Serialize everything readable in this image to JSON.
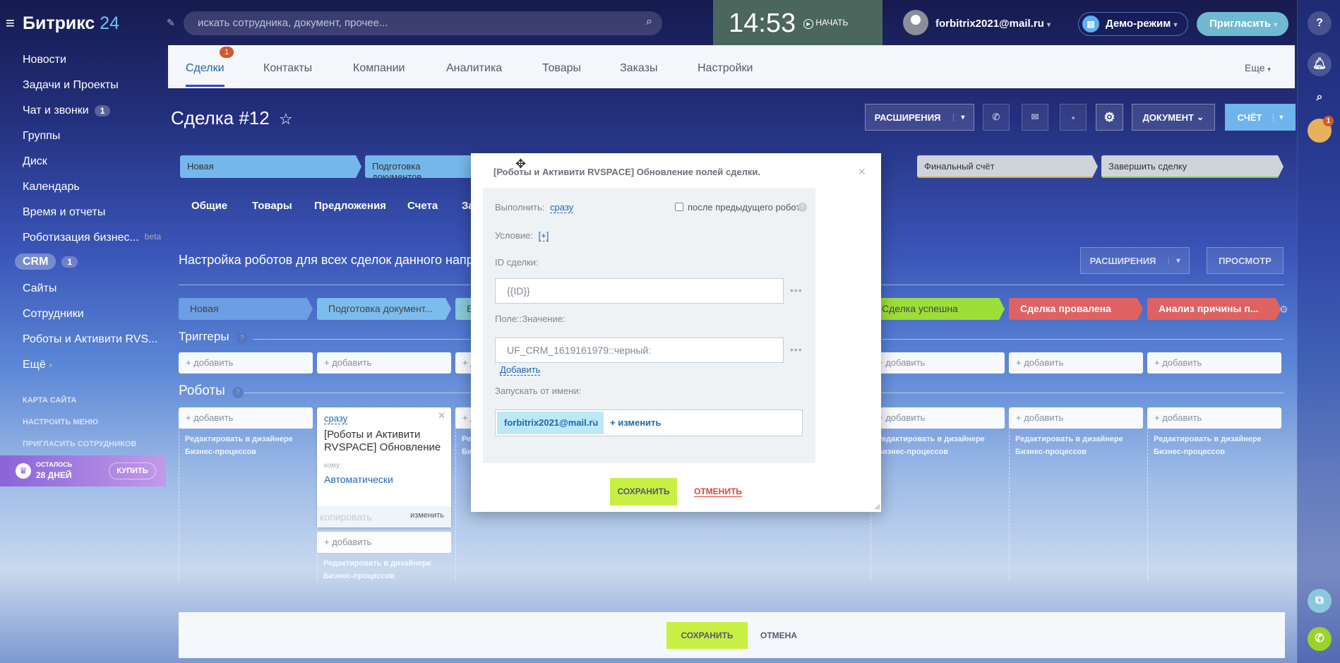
{
  "header": {
    "logo": "Битрикс",
    "logo_num": "24",
    "search_placeholder": "искать сотрудника, документ, прочее...",
    "time": "14:53",
    "start_label": "НАЧАТЬ",
    "user_email": "forbitrix2021@mail.ru",
    "demo_label": "Демо-режим",
    "invite_label": "Пригласить"
  },
  "sidebar": {
    "items": [
      {
        "label": "Новости"
      },
      {
        "label": "Задачи и Проекты"
      },
      {
        "label": "Чат и звонки",
        "count": "1"
      },
      {
        "label": "Группы"
      },
      {
        "label": "Диск"
      },
      {
        "label": "Календарь"
      },
      {
        "label": "Время и отчеты"
      },
      {
        "label": "Роботизация бизнес...",
        "badge": "beta"
      },
      {
        "label": "CRM",
        "count": "1"
      },
      {
        "label": "Сайты"
      },
      {
        "label": "Сотрудники"
      },
      {
        "label": "Роботы и Активити RVS..."
      },
      {
        "label": "Ещё"
      }
    ],
    "links": [
      "КАРТА САЙТА",
      "НАСТРОИТЬ МЕНЮ",
      "ПРИГЛАСИТЬ СОТРУДНИКОВ"
    ],
    "promo": {
      "line1": "ОСТАЛОСЬ",
      "line2": "28 ДНЕЙ",
      "button": "КУПИТЬ"
    }
  },
  "crm_tabs": {
    "items": [
      "Сделки",
      "Контакты",
      "Компании",
      "Аналитика",
      "Товары",
      "Заказы",
      "Настройки"
    ],
    "deals_badge": "1",
    "more": "Еще"
  },
  "deal": {
    "title": "Сделка #12",
    "toolbar": {
      "extensions": "РАСШИРЕНИЯ",
      "document": "ДОКУМЕНТ",
      "invoice": "СЧЁТ"
    },
    "progress": [
      "Новая",
      "Подготовка документов",
      "Финальный счёт",
      "Завершить сделку"
    ],
    "sections": [
      "Общие",
      "Товары",
      "Предложения",
      "Счета",
      "За"
    ]
  },
  "robots": {
    "heading": "Настройка роботов для всех сделок данного направл",
    "extensions": "РАСШИРЕНИЯ",
    "preview": "ПРОСМОТР",
    "stages": [
      "Новая",
      "Подготовка документ...",
      "В",
      "",
      "",
      "Сделка успешна",
      "Сделка провалена",
      "Анализ причины п..."
    ],
    "triggers_label": "Триггеры",
    "robots_label": "Роботы",
    "help": "?",
    "add": "+ добавить",
    "edit_bp": "Редактировать в дизайнере Бизнес-процессов",
    "card": {
      "when": "сразу",
      "title": "[Роботы и Активити RVSPACE] Обновление",
      "to_label": "кому:",
      "to_value": "Автоматически",
      "copy": "копировать",
      "edit": "изменить"
    },
    "save": "СОХРАНИТЬ",
    "cancel": "ОТМЕНА"
  },
  "dialog": {
    "title": "[Роботы и Активити RVSPACE] Обновление полей сделки.",
    "run_label": "Выполнить:",
    "run_value": "сразу",
    "after_prev": "после предыдущего робота",
    "condition_label": "Условие:",
    "condition_value": "[+]",
    "deal_id_label": "ID сделки:",
    "deal_id_value": "{{ID}}",
    "field_value_label": "Поле::Значение:",
    "field_value": "UF_CRM_1619161979::черный:",
    "add_link": "Добавить",
    "run_as_label": "Запускать от имени:",
    "run_as_user": "forbitrix2021@mail.ru",
    "change": "изменить",
    "save": "СОХРАНИТЬ",
    "cancel": "ОТМЕНИТЬ"
  },
  "rail": {
    "avatar_badge": "1"
  }
}
